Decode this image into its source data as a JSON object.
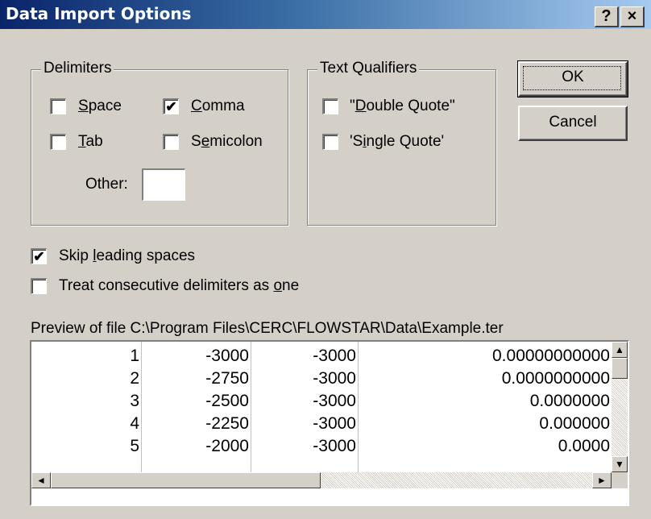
{
  "window": {
    "title": "Data Import Options",
    "help_label": "?",
    "close_label": "×"
  },
  "delimiters": {
    "label": "Delimiters",
    "space": {
      "label": "Space",
      "checked": false
    },
    "comma": {
      "label": "Comma",
      "checked": true
    },
    "tab": {
      "label": "Tab",
      "checked": false
    },
    "semicolon": {
      "label": "Semicolon",
      "checked": false
    },
    "other_label": "Other:",
    "other_value": ""
  },
  "text_qualifiers": {
    "label": "Text Qualifiers",
    "double_quote": {
      "label": "\"Double Quote\"",
      "checked": false
    },
    "single_quote": {
      "label": "'Single Quote'",
      "checked": false
    }
  },
  "buttons": {
    "ok": "OK",
    "cancel": "Cancel"
  },
  "options": {
    "skip_leading_spaces": {
      "label": "Skip leading spaces",
      "checked": true
    },
    "treat_consecutive": {
      "label": "Treat consecutive delimiters as one",
      "checked": false
    }
  },
  "preview": {
    "label": "Preview of file C:\\Program Files\\CERC\\FLOWSTAR\\Data\\Example.ter",
    "rows": [
      [
        "1",
        "-3000",
        "-3000",
        "0.00000000000"
      ],
      [
        "2",
        "-2750",
        "-3000",
        "0.0000000000"
      ],
      [
        "3",
        "-2500",
        "-3000",
        "0.0000000"
      ],
      [
        "4",
        "-2250",
        "-3000",
        "0.000000"
      ],
      [
        "5",
        "-2000",
        "-3000",
        "0.0000"
      ]
    ]
  },
  "scrollbars": {
    "up_arrow": "▲",
    "down_arrow": "▼",
    "left_arrow": "◄",
    "right_arrow": "►"
  }
}
